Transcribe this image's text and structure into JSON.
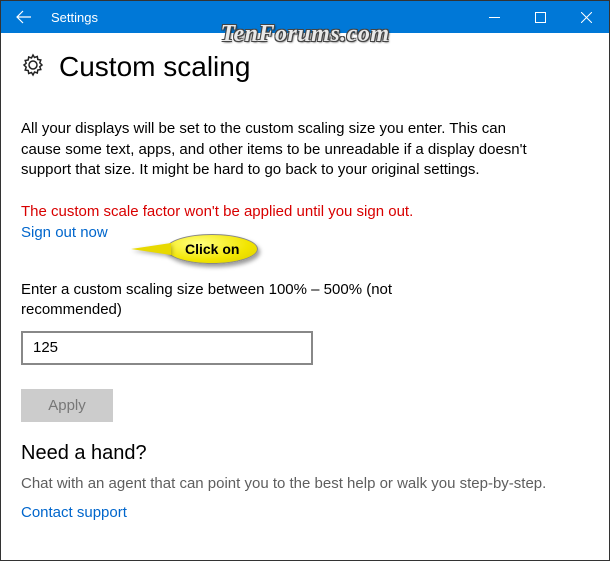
{
  "window": {
    "title": "Settings"
  },
  "watermark": "TenForums.com",
  "page": {
    "title": "Custom scaling",
    "description": "All your displays will be set to the custom scaling size you enter. This can cause some text, apps, and other items to be unreadable if a display doesn't support that size. It might be hard to go back to your original settings.",
    "warning": "The custom scale factor won't be applied until you sign out.",
    "signout_label": "Sign out now",
    "callout_text": "Click on",
    "field_label": "Enter a custom scaling size between 100% – 500% (not recommended)",
    "field_value": "125",
    "apply_label": "Apply"
  },
  "help": {
    "heading": "Need a hand?",
    "text": "Chat with an agent that can point you to the best help or walk you step-by-step.",
    "contact_label": "Contact support"
  }
}
